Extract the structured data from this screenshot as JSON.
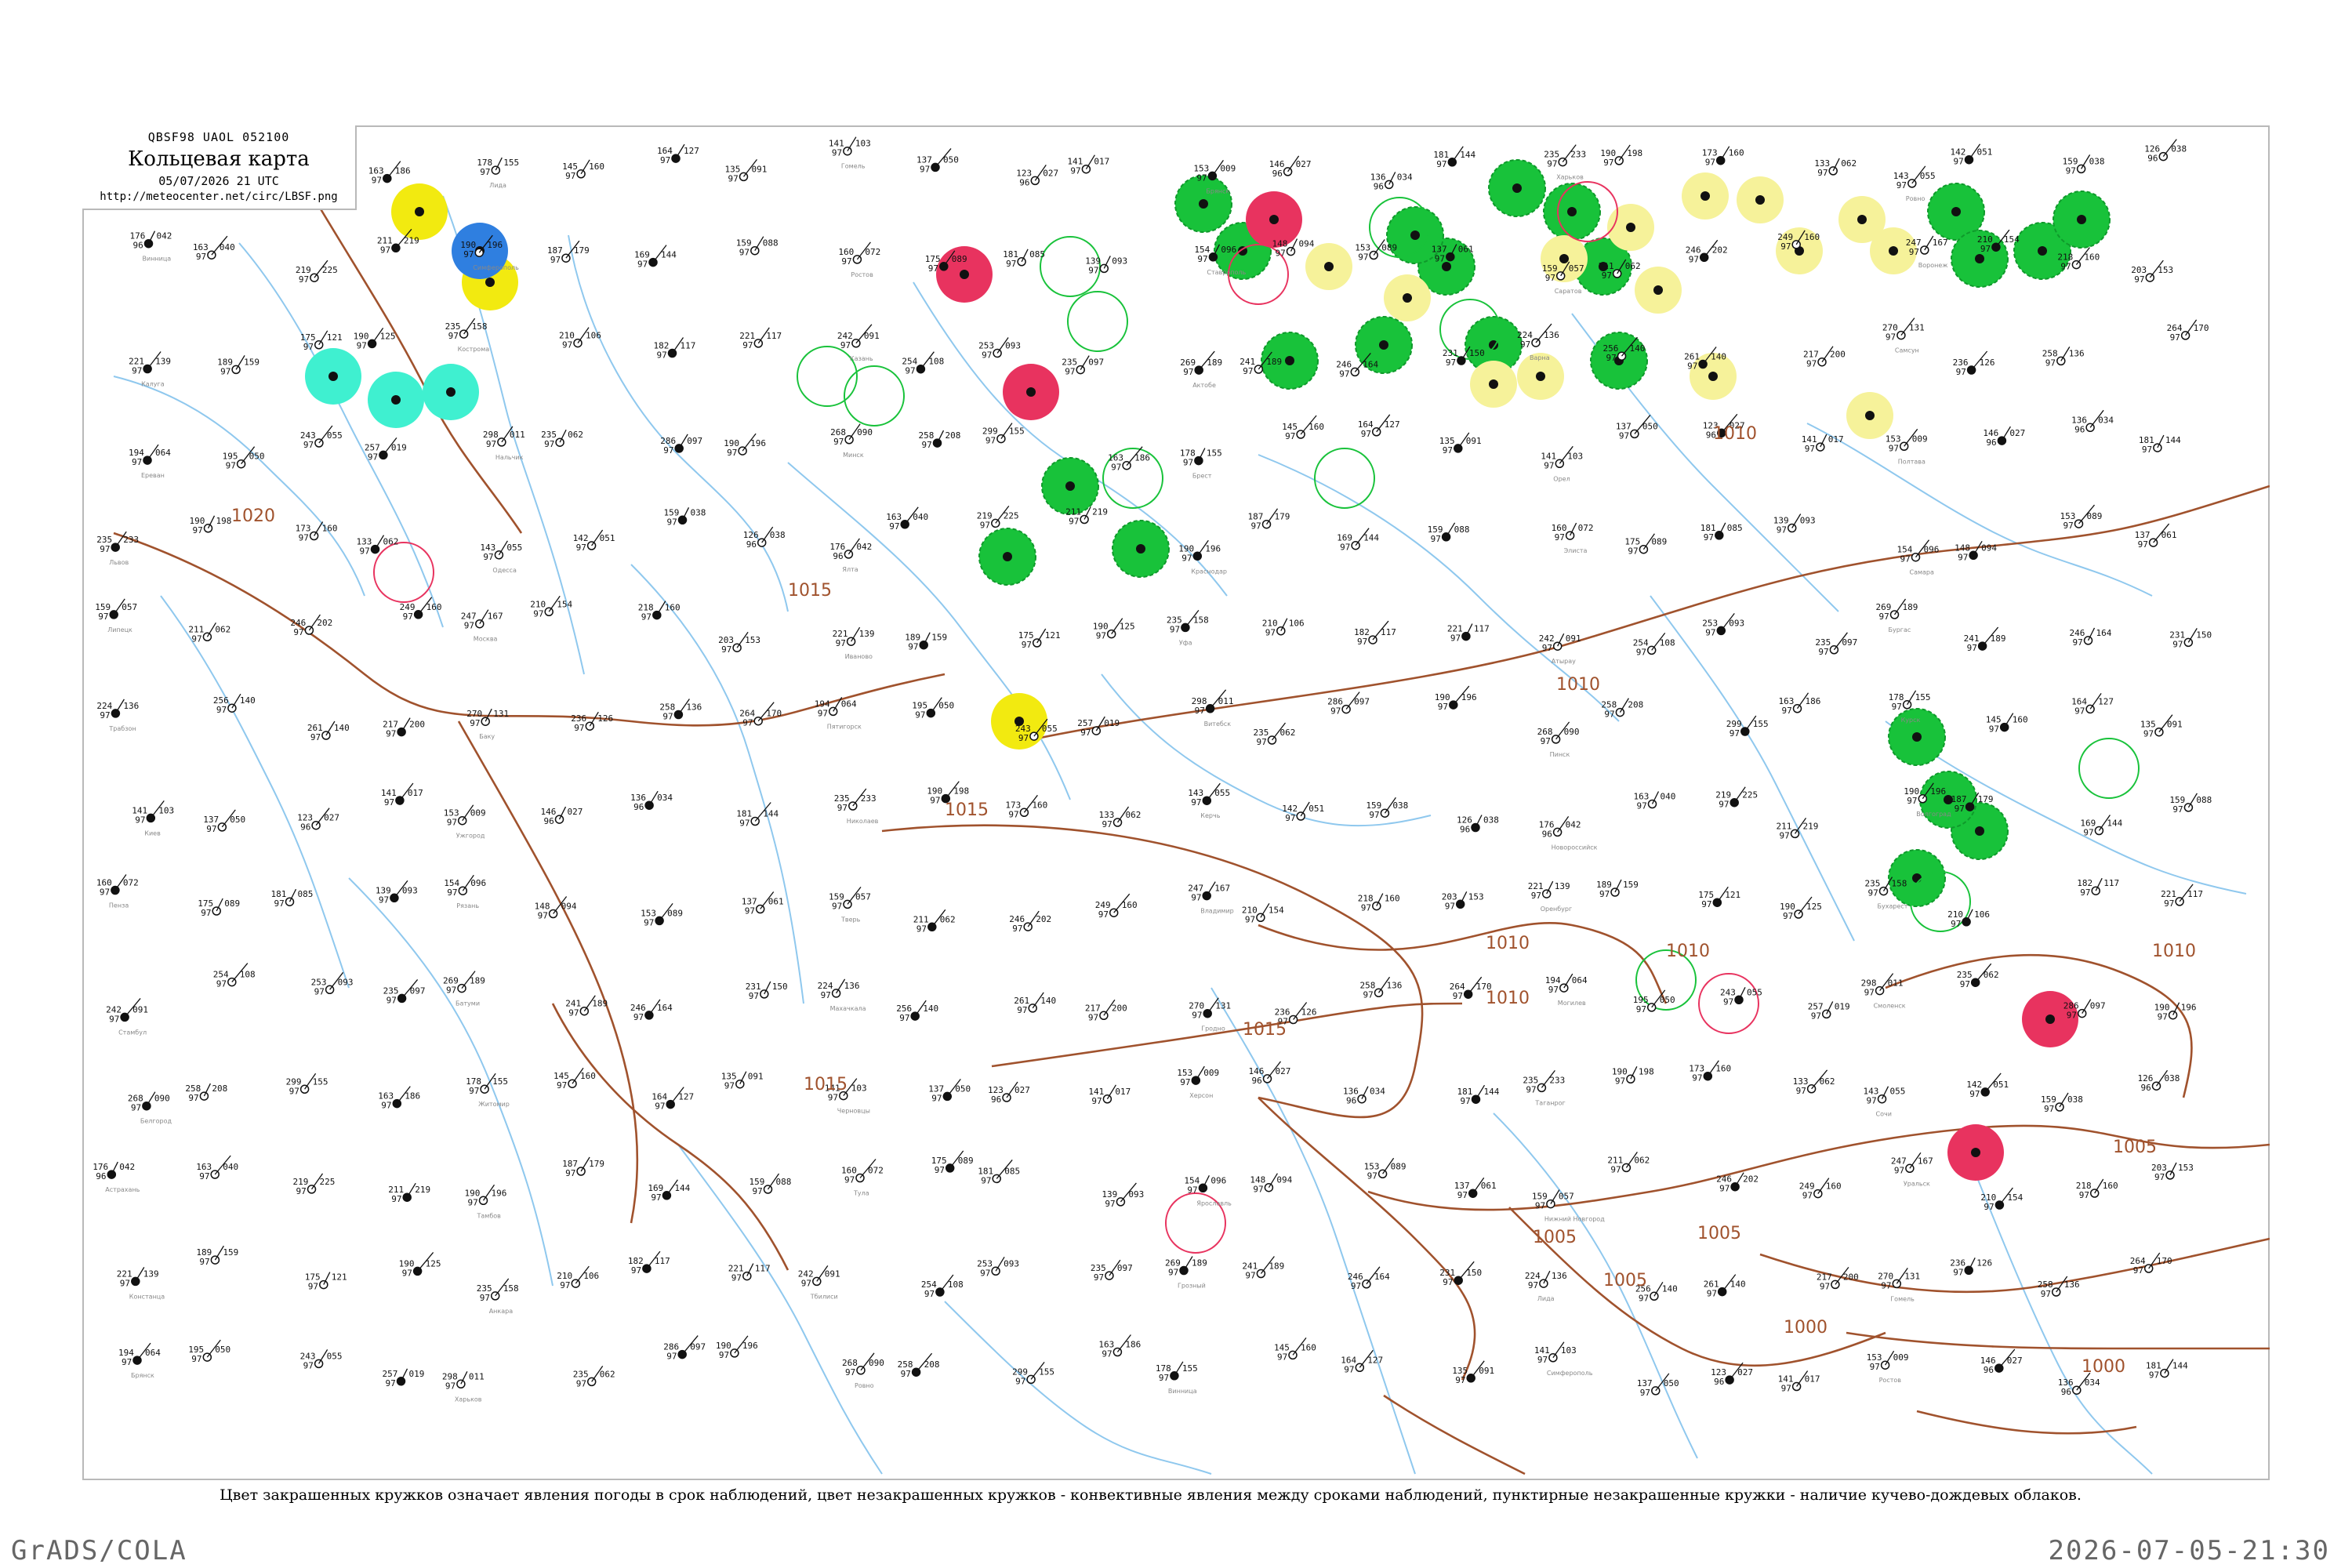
{
  "header": {
    "code_line": "QBSF98  UAOL  052100",
    "title": "Кольцевая карта",
    "datetime": "05/07/2026 21 UTC",
    "url": "http://meteocenter.net/circ/LBSF.png"
  },
  "caption": "Цвет закрашенных кружков означает явления погоды в срок наблюдений, цвет незакрашенных кружков - конвективные явления между сроками наблюдений, пунктирные незакрашенные кружки - наличие кучево-дождевых облаков.",
  "footer": {
    "left": "GrADS/COLA",
    "right": "2026-07-05-21:30"
  },
  "colors": {
    "isobar": "#a0522d",
    "river": "#8fc8ee",
    "green": "#18c23a",
    "yellow": "#f2ea10",
    "light_yellow": "#f6f29a",
    "red": "#e8335f",
    "cyan": "#3ff0d0",
    "blue": "#2f7fe0",
    "frame": "#b9b9b9"
  },
  "isobar_labels": [
    "1020",
    "1015",
    "1015",
    "1015",
    "1015",
    "1010",
    "1010",
    "1010",
    "1010",
    "1010",
    "1010",
    "1005",
    "1005",
    "1005",
    "1005",
    "1000",
    "1000"
  ],
  "filled_markers": [
    {
      "color": "green"
    },
    {
      "color": "green"
    },
    {
      "color": "green"
    },
    {
      "color": "green"
    },
    {
      "color": "green"
    },
    {
      "color": "green"
    },
    {
      "color": "green"
    },
    {
      "color": "green"
    },
    {
      "color": "green"
    },
    {
      "color": "green"
    },
    {
      "color": "green"
    },
    {
      "color": "green"
    },
    {
      "color": "green"
    },
    {
      "color": "green"
    },
    {
      "color": "green"
    },
    {
      "color": "green"
    },
    {
      "color": "green"
    },
    {
      "color": "green"
    },
    {
      "color": "green"
    },
    {
      "color": "green"
    },
    {
      "color": "green"
    },
    {
      "color": "green"
    },
    {
      "color": "yellow"
    },
    {
      "color": "yellow"
    },
    {
      "color": "yellow"
    },
    {
      "color": "red"
    },
    {
      "color": "red"
    },
    {
      "color": "red"
    },
    {
      "color": "red"
    },
    {
      "color": "red"
    },
    {
      "color": "cyan"
    },
    {
      "color": "cyan"
    },
    {
      "color": "cyan"
    },
    {
      "color": "blue"
    },
    {
      "color": "light_yellow"
    },
    {
      "color": "light_yellow"
    },
    {
      "color": "light_yellow"
    },
    {
      "color": "light_yellow"
    },
    {
      "color": "light_yellow"
    },
    {
      "color": "light_yellow"
    },
    {
      "color": "light_yellow"
    },
    {
      "color": "light_yellow"
    },
    {
      "color": "light_yellow"
    },
    {
      "color": "light_yellow"
    },
    {
      "color": "light_yellow"
    },
    {
      "color": "light_yellow"
    },
    {
      "color": "light_yellow"
    },
    {
      "color": "light_yellow"
    }
  ],
  "hollow_markers": [
    {
      "color": "green"
    },
    {
      "color": "green"
    },
    {
      "color": "green"
    },
    {
      "color": "green"
    },
    {
      "color": "green"
    },
    {
      "color": "green"
    },
    {
      "color": "green"
    },
    {
      "color": "green"
    },
    {
      "color": "green"
    },
    {
      "color": "green"
    },
    {
      "color": "green"
    },
    {
      "color": "red"
    },
    {
      "color": "red"
    },
    {
      "color": "red"
    },
    {
      "color": "red"
    },
    {
      "color": "red"
    }
  ],
  "stations": [
    {
      "t": "163",
      "p": "186",
      "v": "97"
    },
    {
      "t": "178",
      "p": "155",
      "v": "97"
    },
    {
      "t": "145",
      "p": "160",
      "v": "97"
    },
    {
      "t": "164",
      "p": "127",
      "v": "97"
    },
    {
      "t": "135",
      "p": "091",
      "v": "97"
    },
    {
      "t": "141",
      "p": "103",
      "v": "97"
    },
    {
      "t": "137",
      "p": "050",
      "v": "97"
    },
    {
      "t": "123",
      "p": "027",
      "v": "96"
    },
    {
      "t": "141",
      "p": "017",
      "v": "97"
    },
    {
      "t": "153",
      "p": "009",
      "v": "97"
    },
    {
      "t": "146",
      "p": "027",
      "v": "96"
    },
    {
      "t": "136",
      "p": "034",
      "v": "96"
    },
    {
      "t": "181",
      "p": "144",
      "v": "97"
    },
    {
      "t": "235",
      "p": "233",
      "v": "97"
    },
    {
      "t": "190",
      "p": "198",
      "v": "97"
    },
    {
      "t": "173",
      "p": "160",
      "v": "97"
    },
    {
      "t": "133",
      "p": "062",
      "v": "97"
    },
    {
      "t": "143",
      "p": "055",
      "v": "97"
    },
    {
      "t": "142",
      "p": "051",
      "v": "97"
    },
    {
      "t": "159",
      "p": "038",
      "v": "97"
    },
    {
      "t": "126",
      "p": "038",
      "v": "96"
    },
    {
      "t": "176",
      "p": "042",
      "v": "96"
    },
    {
      "t": "163",
      "p": "040",
      "v": "97"
    },
    {
      "t": "219",
      "p": "225",
      "v": "97"
    },
    {
      "t": "211",
      "p": "219",
      "v": "97"
    },
    {
      "t": "190",
      "p": "196",
      "v": "97"
    },
    {
      "t": "187",
      "p": "179",
      "v": "97"
    },
    {
      "t": "169",
      "p": "144",
      "v": "97"
    },
    {
      "t": "159",
      "p": "088",
      "v": "97"
    },
    {
      "t": "160",
      "p": "072",
      "v": "97"
    },
    {
      "t": "175",
      "p": "089",
      "v": "97"
    },
    {
      "t": "181",
      "p": "085",
      "v": "97"
    },
    {
      "t": "139",
      "p": "093",
      "v": "97"
    },
    {
      "t": "154",
      "p": "096",
      "v": "97"
    },
    {
      "t": "148",
      "p": "094",
      "v": "97"
    },
    {
      "t": "153",
      "p": "089",
      "v": "97"
    },
    {
      "t": "137",
      "p": "061",
      "v": "97"
    },
    {
      "t": "159",
      "p": "057",
      "v": "97"
    },
    {
      "t": "211",
      "p": "062",
      "v": "97"
    },
    {
      "t": "246",
      "p": "202",
      "v": "97"
    },
    {
      "t": "249",
      "p": "160",
      "v": "97"
    },
    {
      "t": "247",
      "p": "167",
      "v": "97"
    },
    {
      "t": "210",
      "p": "154",
      "v": "97"
    },
    {
      "t": "218",
      "p": "160",
      "v": "97"
    },
    {
      "t": "203",
      "p": "153",
      "v": "97"
    },
    {
      "t": "221",
      "p": "139",
      "v": "97"
    },
    {
      "t": "189",
      "p": "159",
      "v": "97"
    },
    {
      "t": "175",
      "p": "121",
      "v": "97"
    },
    {
      "t": "190",
      "p": "125",
      "v": "97"
    },
    {
      "t": "235",
      "p": "158",
      "v": "97"
    },
    {
      "t": "210",
      "p": "106",
      "v": "97"
    },
    {
      "t": "182",
      "p": "117",
      "v": "97"
    },
    {
      "t": "221",
      "p": "117",
      "v": "97"
    },
    {
      "t": "242",
      "p": "091",
      "v": "97"
    },
    {
      "t": "254",
      "p": "108",
      "v": "97"
    },
    {
      "t": "253",
      "p": "093",
      "v": "97"
    },
    {
      "t": "235",
      "p": "097",
      "v": "97"
    },
    {
      "t": "269",
      "p": "189",
      "v": "97"
    },
    {
      "t": "241",
      "p": "189",
      "v": "97"
    },
    {
      "t": "246",
      "p": "164",
      "v": "97"
    },
    {
      "t": "231",
      "p": "150",
      "v": "97"
    },
    {
      "t": "224",
      "p": "136",
      "v": "97"
    },
    {
      "t": "256",
      "p": "140",
      "v": "97"
    },
    {
      "t": "261",
      "p": "140",
      "v": "97"
    },
    {
      "t": "217",
      "p": "200",
      "v": "97"
    },
    {
      "t": "270",
      "p": "131",
      "v": "97"
    },
    {
      "t": "236",
      "p": "126",
      "v": "97"
    },
    {
      "t": "258",
      "p": "136",
      "v": "97"
    },
    {
      "t": "264",
      "p": "170",
      "v": "97"
    },
    {
      "t": "194",
      "p": "064",
      "v": "97"
    },
    {
      "t": "195",
      "p": "050",
      "v": "97"
    },
    {
      "t": "243",
      "p": "055",
      "v": "97"
    },
    {
      "t": "257",
      "p": "019",
      "v": "97"
    },
    {
      "t": "298",
      "p": "011",
      "v": "97"
    },
    {
      "t": "235",
      "p": "062",
      "v": "97"
    },
    {
      "t": "286",
      "p": "097",
      "v": "97"
    },
    {
      "t": "190",
      "p": "196",
      "v": "97"
    },
    {
      "t": "268",
      "p": "090",
      "v": "97"
    },
    {
      "t": "258",
      "p": "208",
      "v": "97"
    },
    {
      "t": "299",
      "p": "155",
      "v": "97"
    }
  ],
  "station_names": [
    "Гродно",
    "Лида",
    "Минск",
    "Витебск",
    "Могилев",
    "Гомель",
    "Брест",
    "Пинск",
    "Смоленск",
    "Брянск",
    "Орел",
    "Курск",
    "Белгород",
    "Харьков",
    "Полтава",
    "Киев",
    "Житомир",
    "Ровно",
    "Львов",
    "Ужгород",
    "Черновцы",
    "Винница",
    "Одесса",
    "Николаев",
    "Херсон",
    "Симферополь",
    "Ялта",
    "Керчь",
    "Таганрог",
    "Ростов",
    "Краснодар",
    "Новороссийск",
    "Сочи",
    "Ставрополь",
    "Элиста",
    "Волгоград",
    "Астрахань",
    "Саратов",
    "Самара",
    "Пенза",
    "Тамбов",
    "Воронеж",
    "Липецк",
    "Рязань",
    "Тула",
    "Калуга",
    "Москва",
    "Тверь",
    "Ярославль",
    "Кострома",
    "Иваново",
    "Владимир",
    "Нижний Новгород",
    "Казань",
    "Уфа",
    "Оренбург",
    "Уральск",
    "Актобе",
    "Атырау",
    "Бухарест",
    "Констанца",
    "Варна",
    "Бургас",
    "Стамбул",
    "Анкара",
    "Самсун",
    "Трабзон",
    "Батуми",
    "Тбилиси",
    "Ереван",
    "Баку",
    "Махачкала",
    "Грозный",
    "Нальчик",
    "Пятигорск"
  ]
}
